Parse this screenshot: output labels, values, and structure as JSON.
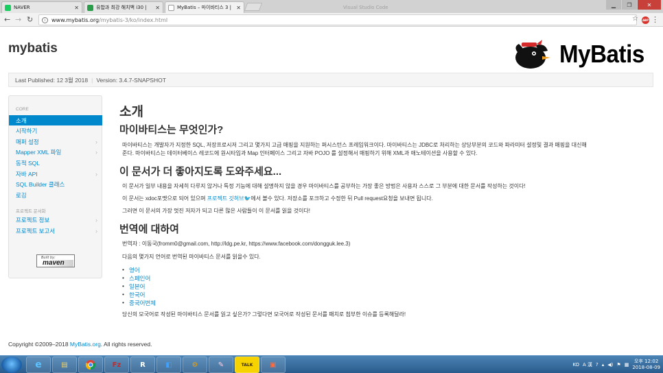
{
  "browser": {
    "tabs": [
      {
        "title": "NAVER",
        "favicon_color": "#19ce60"
      },
      {
        "title": "유합과 최강 해치백 i30 |",
        "favicon_color": "#2a9d4a"
      },
      {
        "title": "MyBatis – 마이바티스 3 |",
        "favicon_color": "#ffffff"
      }
    ],
    "ghost_tab": "Visual Studio Code",
    "url_domain": "www.mybatis.org",
    "url_path": "/mybatis-3/ko/index.html",
    "abp_label": "ABP"
  },
  "site": {
    "title": "mybatis",
    "logo_text": "MyBatis",
    "last_published": "Last Published: 12 3월 2018",
    "version": "Version: 3.4.7-SNAPSHOT"
  },
  "sidebar": {
    "header_core": "CORE",
    "items": [
      {
        "label": "소개",
        "active": true,
        "chevron": false
      },
      {
        "label": "시작하기",
        "active": false,
        "chevron": false
      },
      {
        "label": "매퍼 설정",
        "active": false,
        "chevron": true
      },
      {
        "label": "Mapper XML 파일",
        "active": false,
        "chevron": true
      },
      {
        "label": "동적 SQL",
        "active": false,
        "chevron": false
      },
      {
        "label": "자바 API",
        "active": false,
        "chevron": true
      },
      {
        "label": "SQL Builder 클래스",
        "active": false,
        "chevron": false
      },
      {
        "label": "로깅",
        "active": false,
        "chevron": false
      }
    ],
    "header_docs": "프로젝트 문서화",
    "doc_items": [
      {
        "label": "프로젝트 정보",
        "chevron": true
      },
      {
        "label": "프로젝트 보고서",
        "chevron": true
      }
    ],
    "maven_built": "Built by:",
    "maven_label": "maven"
  },
  "content": {
    "h1": "소개",
    "h2_what": "마이바티스는 무엇인가?",
    "what_p1": "마이바티스는 개발자가 지정한 SQL, 저장프로시저 그리고 몇가지 고급 매핑을 지원하는 퍼시스턴스 프레임워크이다. 마이바티스는 JDBC로 처리하는 상당부분의 코드와 파라미터 설정및 결과 매핑을 대신해",
    "what_p2": "준다. 마이바티스는 데이터베이스 레코드에 원시타입과 Map 인터페이스 그리고 자바 POJO 를 설정해서 매핑하기 위해 XML과 애노테이션을 사용할 수 있다.",
    "h2_help": "이 문서가 더 좋아지도록 도와주세요...",
    "help_p1": "이 문서가 일부 내용을 자세히 다루지 않거나 특정 기능에 대해 설명하지 않을 경우 마이바티스를 공부하는 가장 좋은 방법은 사용자 스스로 그 부분에 대한 문서를 작성하는 것이다!",
    "help_p2_pre": "이 문서는 xdoc포맷으로 되어 있으며 ",
    "help_p2_link": "프로젝트 깃허브",
    "help_p2_post": "에서 볼수 있다. 저장소를 포크하고 수정한 뒤 Pull request요청을 보내면 됩니다.",
    "help_p3": "그러면 이 문서의 가장 멋진 저자가 되고 다른 많은 사람들이 이 문서를 읽을 것이다!",
    "h2_trans": "번역에 대하여",
    "trans_p1": "번역자 : 이동국(fromm0@gmail.com, http://ldg.pe.kr, https://www.facebook.com/dongguk.lee.3)",
    "trans_p2": "다음의 몇가지 언어로 번역된 마이바티스 문서를 읽을수 있다.",
    "languages": [
      "영어",
      "스페인어",
      "일본어",
      "한국어",
      "중국어번체"
    ],
    "trans_p3": "당신의 모국어로 작성된 마이바티스 문서를 읽고 싶은가? 그렇다면 모국어로 작성된 문서를 패치로 첨부한 이슈를 등록해달라!"
  },
  "footer": {
    "pre": "Copyright ©2009–2018 ",
    "link": "MyBatis.org",
    "post": ". All rights reserved."
  },
  "taskbar": {
    "ime": "KO",
    "ime_mode": "A 漢",
    "time": "오후 12:02",
    "date": "2018-08-09"
  }
}
